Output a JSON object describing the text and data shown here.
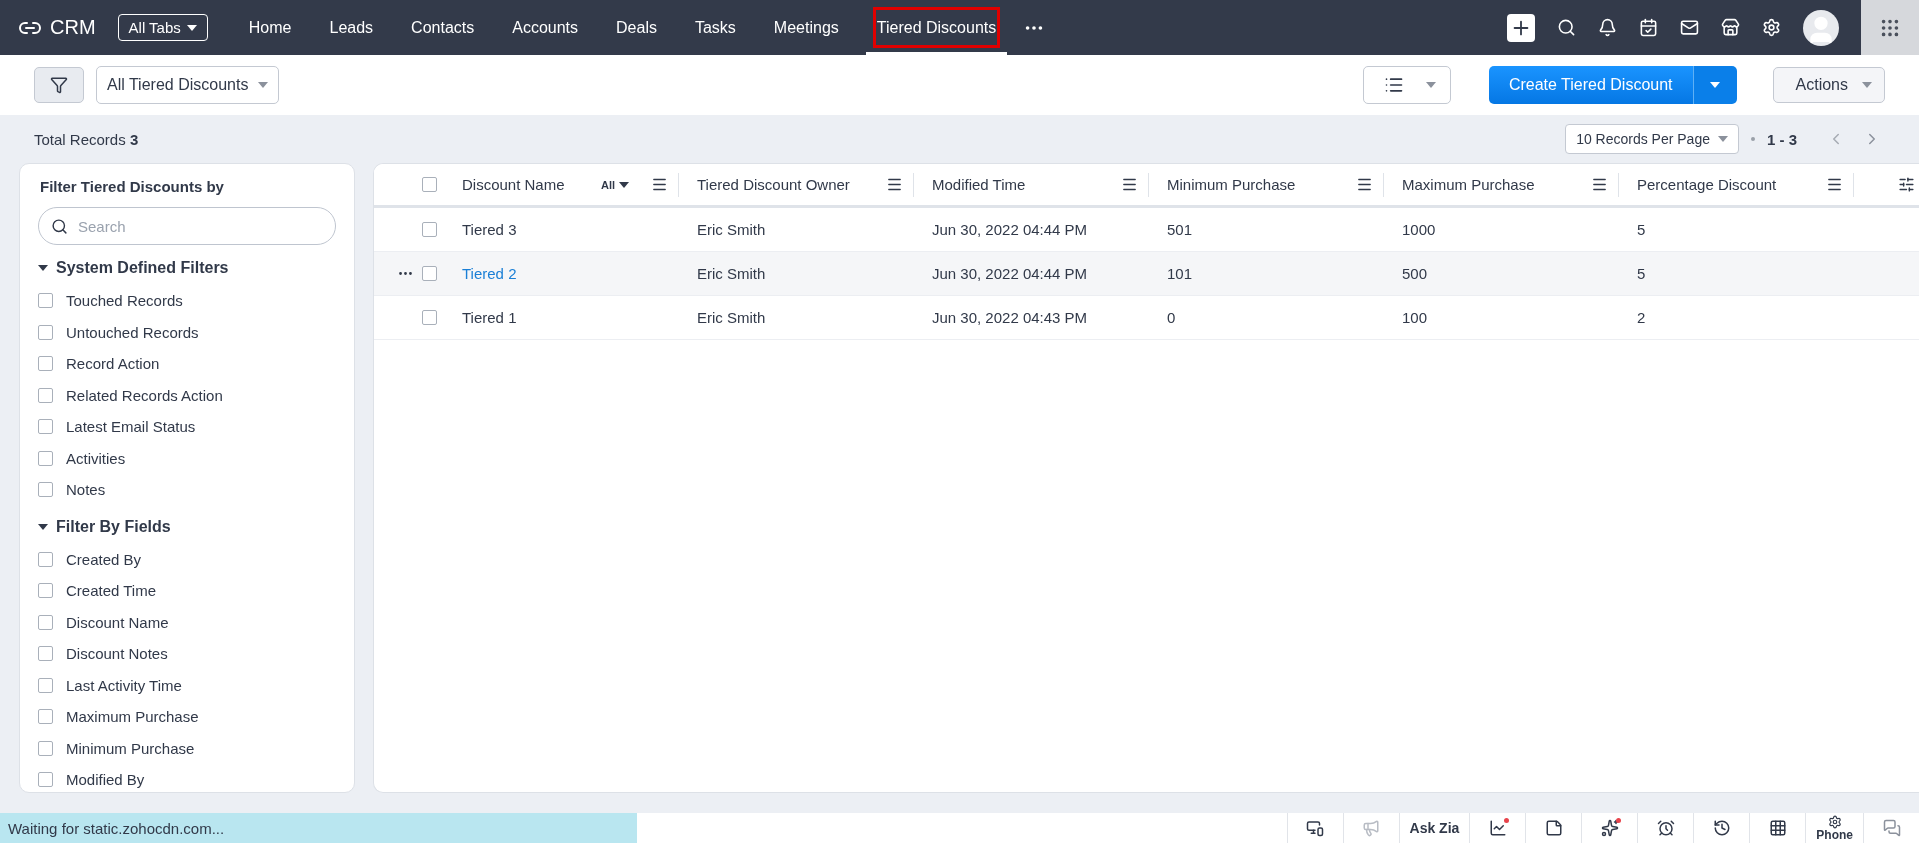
{
  "nav": {
    "brand": "CRM",
    "all_tabs": "All Tabs",
    "tabs": [
      {
        "label": "Home",
        "selected": false,
        "highlighted": false
      },
      {
        "label": "Leads",
        "selected": false,
        "highlighted": false
      },
      {
        "label": "Contacts",
        "selected": false,
        "highlighted": false
      },
      {
        "label": "Accounts",
        "selected": false,
        "highlighted": false
      },
      {
        "label": "Deals",
        "selected": false,
        "highlighted": false
      },
      {
        "label": "Tasks",
        "selected": false,
        "highlighted": false
      },
      {
        "label": "Meetings",
        "selected": false,
        "highlighted": false
      },
      {
        "label": "Tiered Discounts",
        "selected": true,
        "highlighted": true
      }
    ]
  },
  "toolbar": {
    "view": "All Tiered Discounts",
    "create_button": "Create Tiered Discount",
    "actions": "Actions"
  },
  "summary": {
    "label": "Total Records",
    "count": "3"
  },
  "pagination": {
    "per_page": "10 Records Per Page",
    "range": "1 - 3"
  },
  "sidebar": {
    "title": "Filter Tiered Discounts by",
    "search": {
      "placeholder": "Search"
    },
    "sections": [
      {
        "title": "System Defined Filters",
        "expanded": true,
        "items": [
          {
            "label": "Touched Records",
            "checked": false
          },
          {
            "label": "Untouched Records",
            "checked": false
          },
          {
            "label": "Record Action",
            "checked": false
          },
          {
            "label": "Related Records Action",
            "checked": false
          },
          {
            "label": "Latest Email Status",
            "checked": false
          },
          {
            "label": "Activities",
            "checked": false
          },
          {
            "label": "Notes",
            "checked": false
          }
        ]
      },
      {
        "title": "Filter By Fields",
        "expanded": true,
        "items": [
          {
            "label": "Created By",
            "checked": false
          },
          {
            "label": "Created Time",
            "checked": false
          },
          {
            "label": "Discount Name",
            "checked": false
          },
          {
            "label": "Discount Notes",
            "checked": false
          },
          {
            "label": "Last Activity Time",
            "checked": false
          },
          {
            "label": "Maximum Purchase",
            "checked": false
          },
          {
            "label": "Minimum Purchase",
            "checked": false
          },
          {
            "label": "Modified By",
            "checked": false
          }
        ]
      }
    ]
  },
  "table": {
    "select_all": {
      "checked": false
    },
    "columns": [
      {
        "label": "Discount Name",
        "filter": "All"
      },
      {
        "label": "Tiered Discount Owner"
      },
      {
        "label": "Modified Time"
      },
      {
        "label": "Minimum Purchase"
      },
      {
        "label": "Maximum Purchase"
      },
      {
        "label": "Percentage Discount"
      }
    ],
    "rows": [
      {
        "checked": false,
        "hovered": false,
        "cells": [
          "Tiered 3",
          "Eric Smith",
          "Jun 30, 2022 04:44 PM",
          "501",
          "1000",
          "5"
        ]
      },
      {
        "checked": false,
        "hovered": true,
        "cells": [
          "Tiered 2",
          "Eric Smith",
          "Jun 30, 2022 04:44 PM",
          "101",
          "500",
          "5"
        ]
      },
      {
        "checked": false,
        "hovered": false,
        "cells": [
          "Tiered 1",
          "Eric Smith",
          "Jun 30, 2022 04:43 PM",
          "0",
          "100",
          "2"
        ]
      }
    ]
  },
  "status_bar": {
    "message": "Waiting for static.zohocdn.com...",
    "tools": [
      {
        "kind": "screen",
        "disabled": false,
        "badge": false
      },
      {
        "kind": "megaphone",
        "disabled": true,
        "badge": false
      },
      {
        "kind": "label",
        "label": "Ask Zia",
        "disabled": false,
        "badge": false
      },
      {
        "kind": "chart",
        "disabled": false,
        "badge": true
      },
      {
        "kind": "note",
        "disabled": false,
        "badge": false
      },
      {
        "kind": "sparkle",
        "disabled": false,
        "badge": true
      },
      {
        "kind": "alarm",
        "disabled": false,
        "badge": false
      },
      {
        "kind": "history",
        "disabled": false,
        "badge": false
      },
      {
        "kind": "dialpad",
        "disabled": false,
        "badge": false
      },
      {
        "kind": "phone",
        "label": "Phone",
        "disabled": false,
        "badge": false
      },
      {
        "kind": "chat",
        "disabled": false,
        "badge": false
      }
    ]
  }
}
